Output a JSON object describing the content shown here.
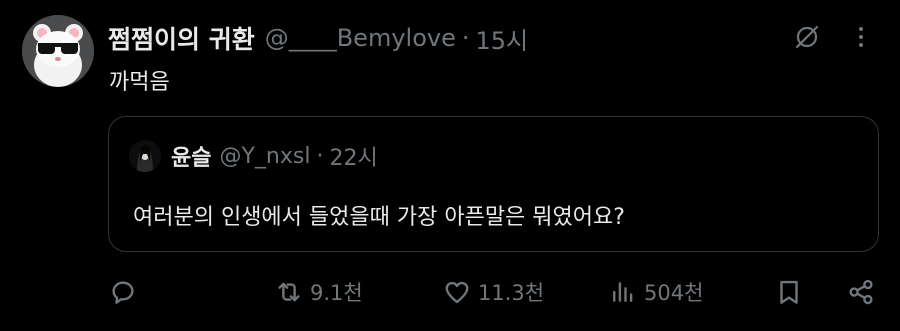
{
  "post": {
    "author_name": "쩜쩜이의 귀환",
    "author_handle": "@____Bemylove",
    "separator": "·",
    "time": "15시",
    "text": "까먹음",
    "avatar_icon": "cartoon-cat-sunglasses-avatar",
    "grok_icon": "grok-slash-circle-icon",
    "more_icon": "more-vertical-icon"
  },
  "quote": {
    "author_name": "윤슬",
    "author_handle": "@Y_nxsl",
    "separator": "·",
    "time": "22시",
    "text": "여러분의 인생에서 들었을때 가장 아픈말은 뭐였어요?",
    "avatar_icon": "dark-portrait-avatar"
  },
  "actions": {
    "reply_icon": "reply-icon",
    "retweet_count": "9.1천",
    "retweet_icon": "retweet-icon",
    "like_count": "11.3천",
    "like_icon": "heart-icon",
    "views_count": "504천",
    "views_icon": "bar-chart-icon",
    "bookmark_icon": "bookmark-icon",
    "share_icon": "share-icon"
  },
  "colors": {
    "background": "#000000",
    "text_primary": "#e7e9ea",
    "text_secondary": "#71767b",
    "border": "#2f3336"
  }
}
